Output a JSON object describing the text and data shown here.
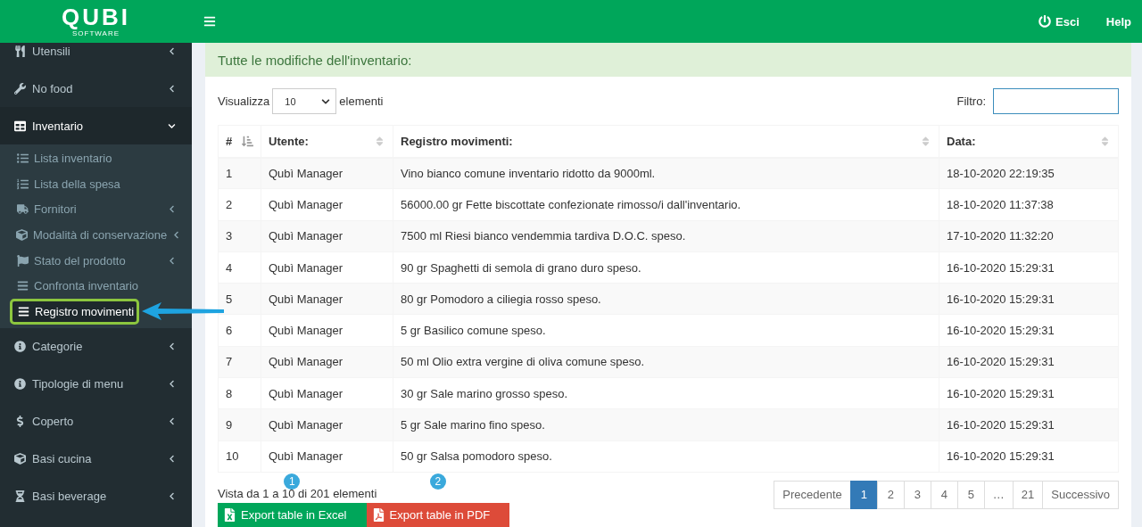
{
  "logo": {
    "name": "QUBI",
    "tagline": "SOFTWARE"
  },
  "topbar": {
    "logout": "Esci",
    "help": "Help"
  },
  "sidebar": {
    "items": [
      {
        "label": "Utensili",
        "expanded": false
      },
      {
        "label": "No food",
        "expanded": false
      },
      {
        "label": "Inventario",
        "expanded": true,
        "children": [
          {
            "label": "Lista inventario",
            "selected": false
          },
          {
            "label": "Lista della spesa",
            "selected": false
          },
          {
            "label": "Fornitori",
            "selected": false,
            "expanded": false
          },
          {
            "label": "Modalità di conservazione",
            "selected": false,
            "expanded": false
          },
          {
            "label": "Stato del prodotto",
            "selected": false,
            "expanded": false
          },
          {
            "label": "Confronta inventario",
            "selected": false
          },
          {
            "label": "Registro movimenti",
            "selected": true,
            "highlighted": true
          }
        ]
      },
      {
        "label": "Categorie",
        "expanded": false
      },
      {
        "label": "Tipologie di menu",
        "expanded": false
      },
      {
        "label": "Coperto",
        "expanded": false
      },
      {
        "label": "Basi cucina",
        "expanded": false
      },
      {
        "label": "Basi beverage",
        "expanded": false
      }
    ]
  },
  "panel": {
    "title": "Tutte le modifiche dell'inventario:",
    "length": {
      "before": "Visualizza",
      "value": "10",
      "after": "elementi"
    },
    "filter": {
      "label": "Filtro:"
    },
    "table": {
      "columns": [
        {
          "label": "#",
          "sorted": true
        },
        {
          "label": "Utente:",
          "sorted": false
        },
        {
          "label": "Registro movimenti:",
          "sorted": false
        },
        {
          "label": "Data:",
          "sorted": false
        }
      ],
      "rows": [
        [
          "1",
          "Qubì Manager",
          "Vino bianco comune inventario ridotto da 9000ml.",
          "18-10-2020 22:19:35"
        ],
        [
          "2",
          "Qubì Manager",
          "56000.00 gr Fette biscottate confezionate rimosso/i dall'inventario.",
          "18-10-2020 11:37:38"
        ],
        [
          "3",
          "Qubì Manager",
          "7500 ml Riesi bianco vendemmia tardiva D.O.C. speso.",
          "17-10-2020 11:32:20"
        ],
        [
          "4",
          "Qubì Manager",
          "90 gr Spaghetti di semola di grano duro speso.",
          "16-10-2020 15:29:31"
        ],
        [
          "5",
          "Qubì Manager",
          "80 gr Pomodoro a ciliegia rosso speso.",
          "16-10-2020 15:29:31"
        ],
        [
          "6",
          "Qubì Manager",
          "5 gr Basilico comune speso.",
          "16-10-2020 15:29:31"
        ],
        [
          "7",
          "Qubì Manager",
          "50 ml Olio extra vergine di oliva comune speso.",
          "16-10-2020 15:29:31"
        ],
        [
          "8",
          "Qubì Manager",
          "30 gr Sale marino grosso speso.",
          "16-10-2020 15:29:31"
        ],
        [
          "9",
          "Qubì Manager",
          "5 gr Sale marino fino speso.",
          "16-10-2020 15:29:31"
        ],
        [
          "10",
          "Qubì Manager",
          "50 gr Salsa pomodoro speso.",
          "16-10-2020 15:29:31"
        ]
      ]
    },
    "info": "Vista da 1 a 10 di 201 elementi",
    "exports": [
      {
        "kind": "excel",
        "label": "Export table in Excel",
        "badge": "1"
      },
      {
        "kind": "pdf",
        "label": "Export table in PDF",
        "badge": "2"
      }
    ],
    "pagination": [
      {
        "label": "Precedente",
        "selected": false
      },
      {
        "label": "1",
        "selected": true
      },
      {
        "label": "2",
        "selected": false
      },
      {
        "label": "3",
        "selected": false
      },
      {
        "label": "4",
        "selected": false
      },
      {
        "label": "5",
        "selected": false
      },
      {
        "label": "…",
        "selected": false
      },
      {
        "label": "21",
        "selected": false
      },
      {
        "label": "Successivo",
        "selected": false
      }
    ]
  }
}
